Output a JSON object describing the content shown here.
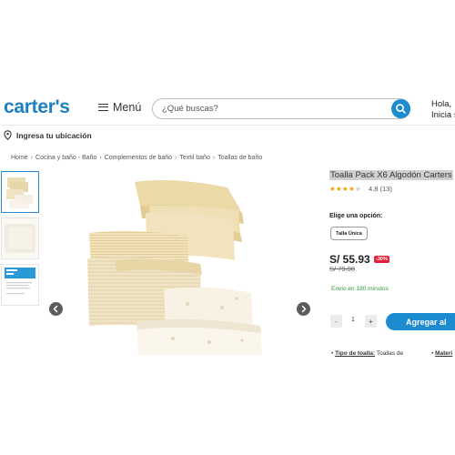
{
  "header": {
    "logo_text": "carter's",
    "menu_label": "Menú",
    "search_placeholder": "¿Qué buscas?",
    "greeting_line1": "Hola,",
    "greeting_line2": "Inicia s",
    "location_label": "Ingresa tu ubicación"
  },
  "breadcrumb": [
    "Home",
    "Cocina y baño - Baño",
    "Complementos de baño",
    "Textil baño",
    "Toallas de baño"
  ],
  "gallery": {
    "thumbnail_count": 3,
    "active_thumbnail": 0
  },
  "product": {
    "title": "Toalla Pack X6 Algodón Carters",
    "rating_value": 4,
    "rating_max": 5,
    "rating_text": "4.8 (13)",
    "option_label": "Elige una opción:",
    "option_selected": "Talla Única",
    "price": "S/ 55.93",
    "discount_badge": "-30%",
    "old_price": "S/ 79.90",
    "shipping_text": "Envío en 180 minutos",
    "quantity": "1",
    "qty_minus": "-",
    "qty_plus": "+",
    "add_button": "Agregar al",
    "spec1_key": "Tipo de toalla:",
    "spec1_value": "Toallas de",
    "spec2_key": "Materi"
  },
  "colors": {
    "brand_blue": "#1b7fc4",
    "button_blue": "#1d8bd0",
    "discount_red": "#e0223a",
    "shipping_green": "#2e9d3a",
    "star_orange": "#f2a000"
  }
}
